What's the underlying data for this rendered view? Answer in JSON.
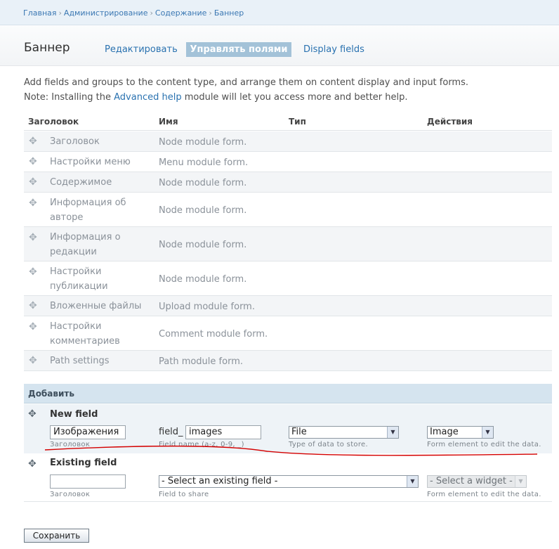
{
  "breadcrumb": [
    "Главная",
    "Администрирование",
    "Содержание",
    "Баннер"
  ],
  "page": {
    "title": "Баннер"
  },
  "tabs": [
    "Редактировать",
    "Управлять полями",
    "Display fields"
  ],
  "help": {
    "line1": "Add fields and groups to the content type, and arrange them on content display and input forms.",
    "line2_before": "Note: Installing the ",
    "line2_link": "Advanced help",
    "line2_after": " module will let you access more and better help."
  },
  "table": {
    "headers": [
      "Заголовок",
      "Имя",
      "Тип",
      "Действия"
    ],
    "rows": [
      {
        "label": "Заголовок",
        "module": "Node module form."
      },
      {
        "label": "Настройки меню",
        "module": "Menu module form."
      },
      {
        "label": "Содержимое",
        "module": "Node module form."
      },
      {
        "label": "Информация об авторе",
        "module": "Node module form."
      },
      {
        "label": "Информация о редакции",
        "module": "Node module form."
      },
      {
        "label": "Настройки публикации",
        "module": "Node module form."
      },
      {
        "label": "Вложенные файлы",
        "module": "Upload module form."
      },
      {
        "label": "Настройки комментариев",
        "module": "Comment module form."
      },
      {
        "label": "Path settings",
        "module": "Path module form."
      }
    ]
  },
  "add": {
    "header": "Добавить",
    "new_field": {
      "label": "New field",
      "label_value": "Изображения",
      "label_desc": "Заголовок",
      "prefix": "field_",
      "name_value": "images",
      "name_desc": "Field name (a-z, 0-9, _)",
      "type_value": "File",
      "type_desc": "Type of data to store.",
      "widget_value": "Image",
      "widget_desc": "Form element to edit the data."
    },
    "existing_field": {
      "label": "Existing field",
      "label_value": "",
      "label_desc": "Заголовок",
      "field_value": "- Select an existing field -",
      "field_desc": "Field to share",
      "widget_value": "- Select a widget -",
      "widget_desc": "Form element to edit the data."
    }
  },
  "save_label": "Сохранить",
  "colors": {
    "link": "#2a72b0",
    "tab_active": "#a3c2d8",
    "add_header": "#d5e4ef",
    "annotation": "#d40000"
  }
}
